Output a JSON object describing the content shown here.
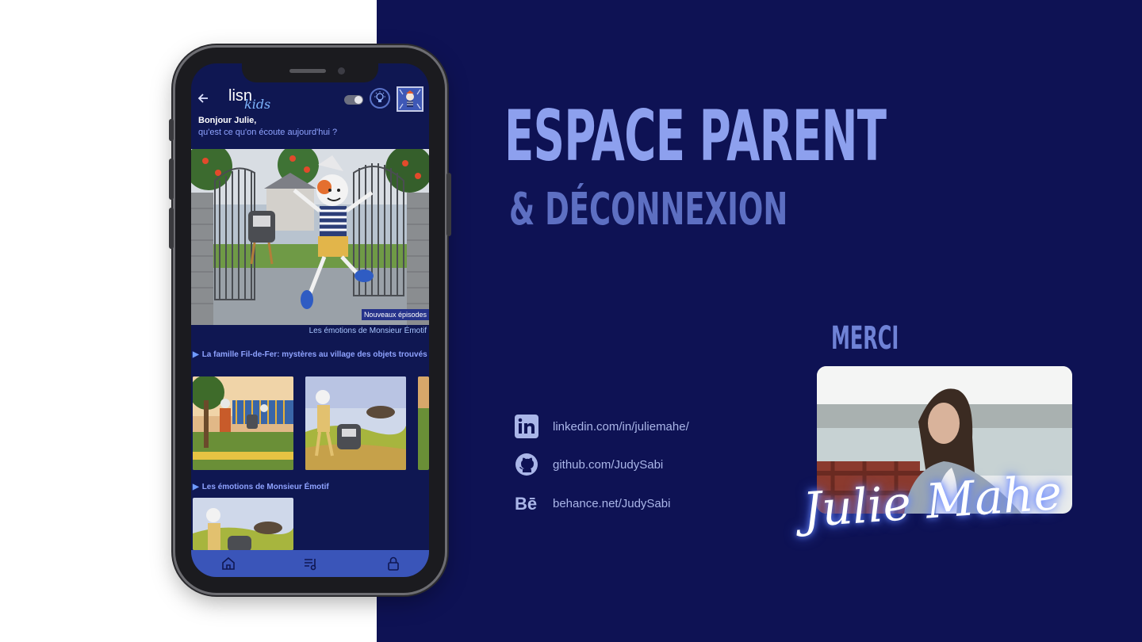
{
  "slide": {
    "title": "ESPACE PARENT",
    "subtitle": "& DÉCONNEXION",
    "thanks": "MERCI",
    "signature": "Julie Mahe"
  },
  "links": [
    {
      "icon": "linkedin-icon",
      "text": "linkedin.com/in/juliemahe/"
    },
    {
      "icon": "github-icon",
      "text": "github.com/JudySabi"
    },
    {
      "icon": "behance-icon",
      "text": "behance.net/JudySabi"
    }
  ],
  "app": {
    "logo": {
      "main": "lisn",
      "sub": "kids"
    },
    "greeting": {
      "title": "Bonjour Julie,",
      "subtitle": "qu'est ce qu'on écoute aujourd'hui ?"
    },
    "hero": {
      "badge": "Nouveaux épisodes",
      "caption": "Les émotions de Monsieur Émotif"
    },
    "sections": [
      {
        "title": "La famille Fil-de-Fer: mystères au village des objets trouvés"
      },
      {
        "title": "Les émotions de Monsieur Émotif"
      }
    ],
    "nav": [
      "home-icon",
      "playlist-icon",
      "lock-icon"
    ]
  },
  "colors": {
    "background_dark": "#0e1254",
    "title": "#8da0ee",
    "subtitle": "#5d6fc2",
    "app_background": "#0f1752",
    "nav_bar": "#3a55b9"
  }
}
